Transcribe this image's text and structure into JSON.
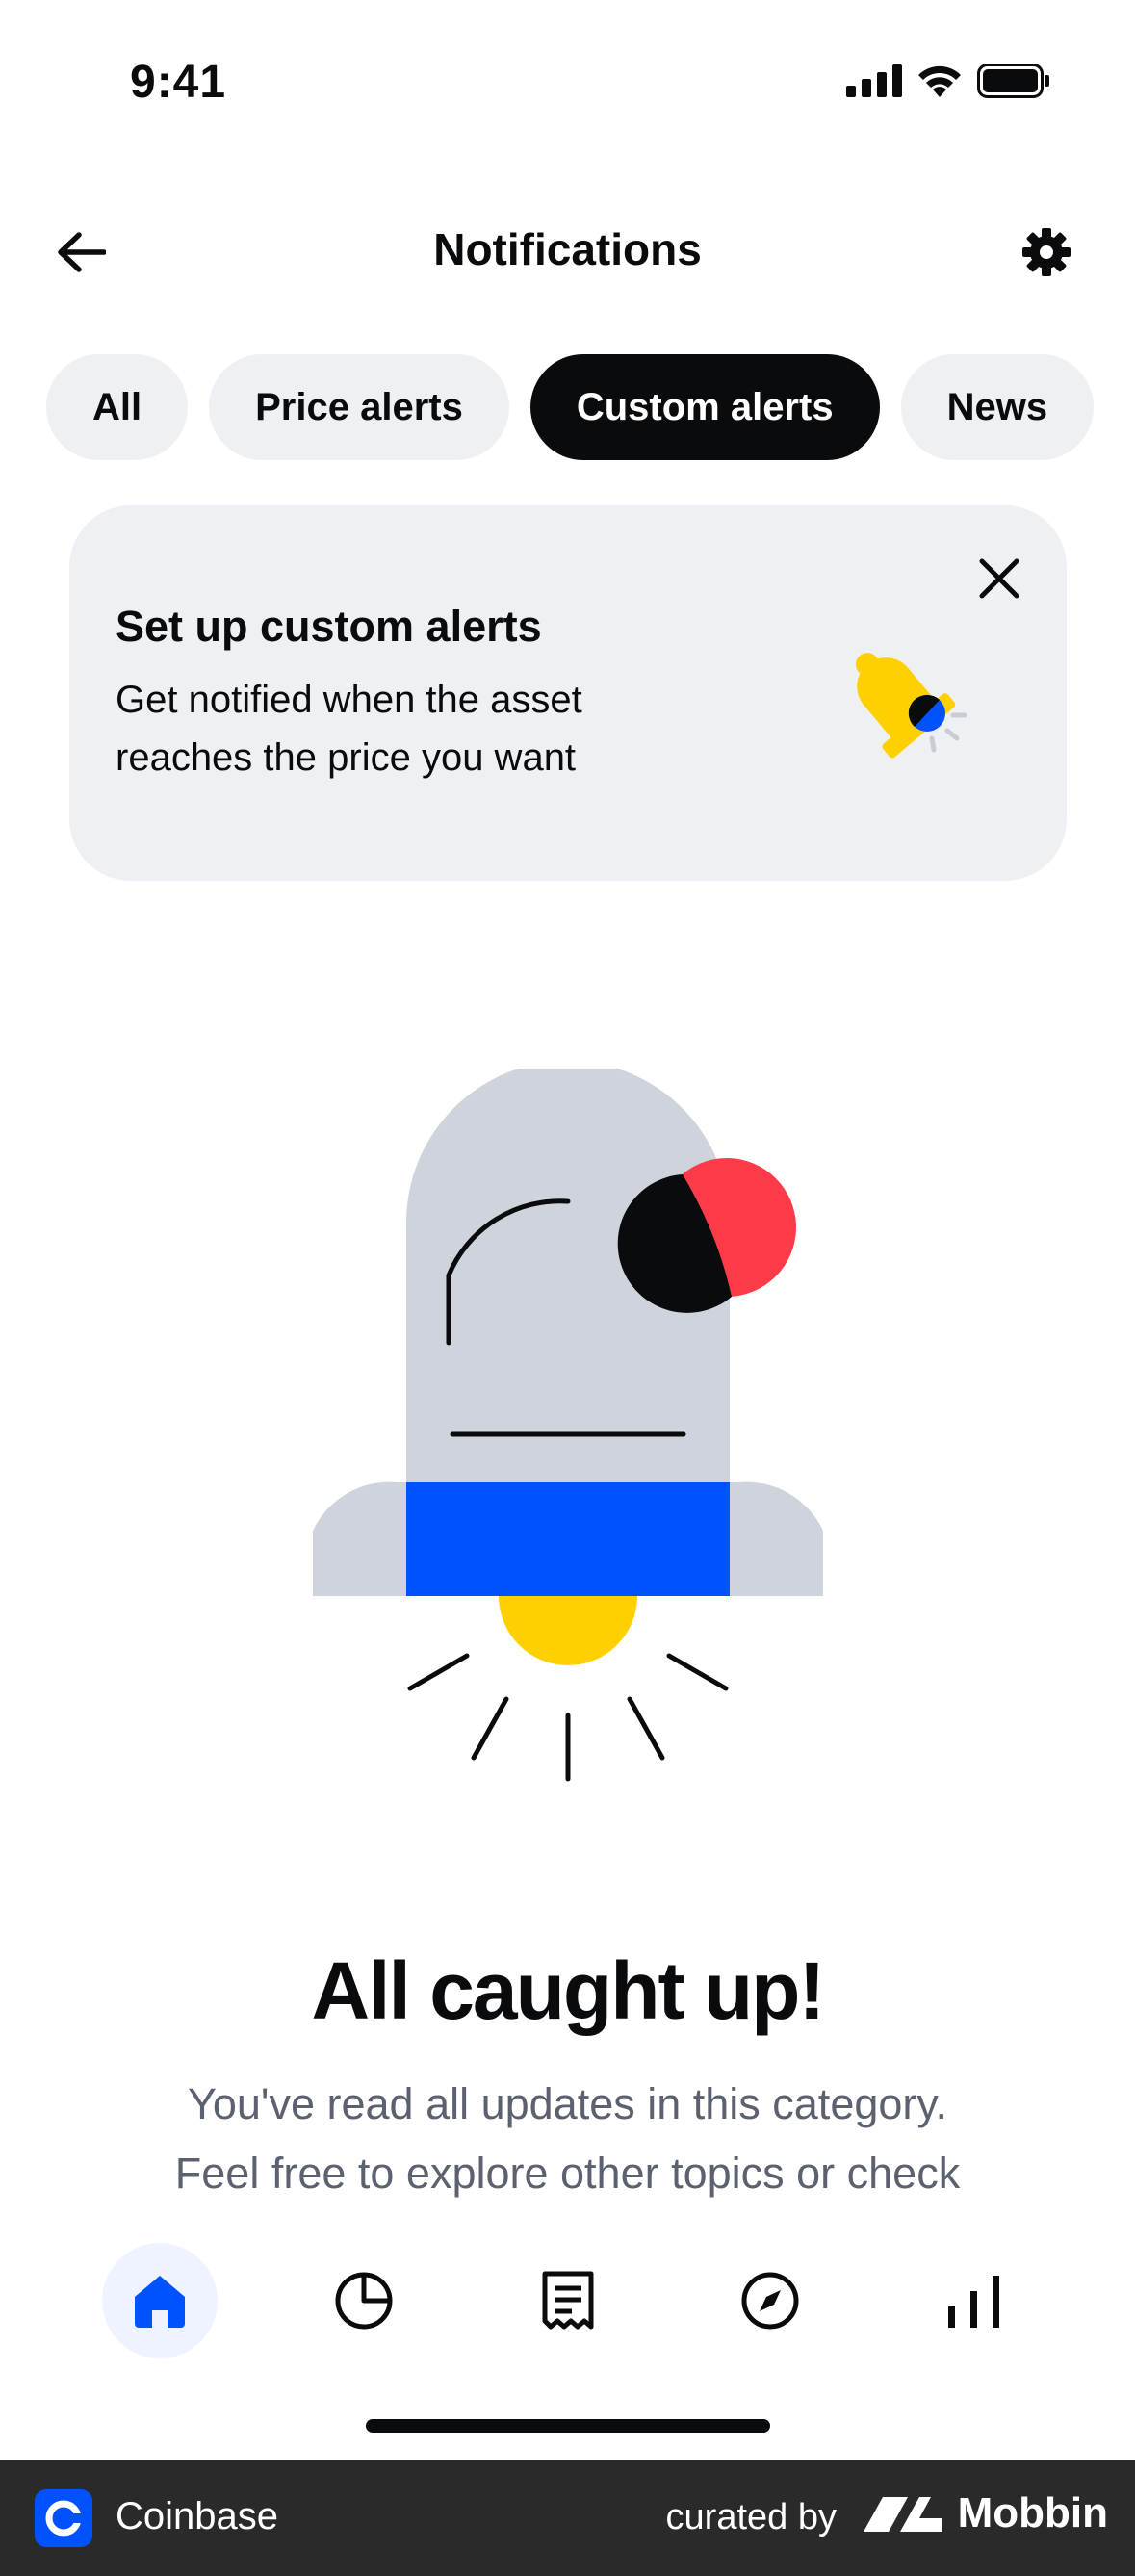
{
  "status_bar": {
    "time": "9:41",
    "icons": [
      "signal-icon",
      "wifi-icon",
      "battery-icon"
    ]
  },
  "header": {
    "title": "Notifications",
    "back_icon": "arrow-left-icon",
    "settings_icon": "gear-icon"
  },
  "filters": {
    "tabs": [
      {
        "label": "All",
        "active": false
      },
      {
        "label": "Price alerts",
        "active": false
      },
      {
        "label": "Custom alerts",
        "active": true
      },
      {
        "label": "News",
        "active": false
      }
    ]
  },
  "promo": {
    "title": "Set up custom alerts",
    "description": "Get notified when the asset reaches the price you want",
    "close_icon": "close-icon",
    "illustration": "bell-icon"
  },
  "empty_state": {
    "title": "All caught up!",
    "description_line1": "You've read all updates in this category.",
    "description_line2": "Feel free to explore other topics or check"
  },
  "tab_bar": {
    "items": [
      {
        "icon": "home-icon",
        "active": true
      },
      {
        "icon": "pie-chart-icon",
        "active": false
      },
      {
        "icon": "receipt-icon",
        "active": false
      },
      {
        "icon": "compass-icon",
        "active": false
      },
      {
        "icon": "bar-chart-icon",
        "active": false
      }
    ]
  },
  "footer": {
    "app_name": "Coinbase",
    "curated_by": "curated by",
    "brand": "Mobbin"
  },
  "colors": {
    "accent_blue": "#0052ff",
    "yellow": "#ffd000",
    "red": "#ff3b4a",
    "chip_bg": "#eef0f3",
    "text_primary": "#0a0b0d",
    "text_secondary": "#5b616e"
  }
}
